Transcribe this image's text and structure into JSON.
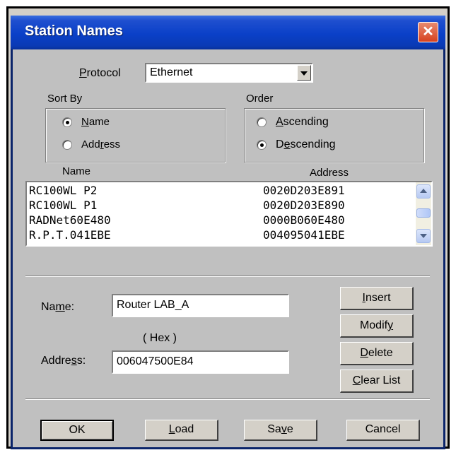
{
  "window": {
    "title": "Station Names",
    "close_symbol": "✕"
  },
  "protocol": {
    "label_pre": "",
    "label_ul": "P",
    "label_post": "rotocol",
    "value": "Ethernet"
  },
  "sort_by": {
    "title": "Sort By",
    "options": [
      {
        "pre": "",
        "ul": "N",
        "post": "ame",
        "selected": true
      },
      {
        "pre": "Add",
        "ul": "r",
        "post": "ess",
        "selected": false
      }
    ]
  },
  "order": {
    "title": "Order",
    "options": [
      {
        "pre": "",
        "ul": "A",
        "post": "scending",
        "selected": false
      },
      {
        "pre": "D",
        "ul": "e",
        "post": "scending",
        "selected": true
      }
    ]
  },
  "list": {
    "col_name": "Name",
    "col_address": "Address",
    "rows": [
      {
        "name": "RC100WL P2",
        "address": "0020D203E891"
      },
      {
        "name": "RC100WL P1",
        "address": "0020D203E890"
      },
      {
        "name": "RADNet60E480",
        "address": "0000B060E480"
      },
      {
        "name": "R.P.T.041EBE",
        "address": "004095041EBE"
      }
    ]
  },
  "form": {
    "name_label": {
      "pre": "Na",
      "ul": "m",
      "post": "e:"
    },
    "name_value": "Router LAB_A",
    "hex_label": "( Hex )",
    "address_label": {
      "pre": "Addre",
      "ul": "s",
      "post": "s:"
    },
    "address_value": "006047500E84"
  },
  "side_buttons": {
    "insert": {
      "pre": "",
      "ul": "I",
      "post": "nsert"
    },
    "modify": {
      "pre": "Modif",
      "ul": "y",
      "post": ""
    },
    "delete": {
      "pre": "",
      "ul": "D",
      "post": "elete"
    },
    "clear": {
      "pre": "",
      "ul": "C",
      "post": "lear List"
    }
  },
  "bottom_buttons": {
    "ok": {
      "pre": "OK",
      "ul": "",
      "post": ""
    },
    "load": {
      "pre": "",
      "ul": "L",
      "post": "oad"
    },
    "save": {
      "pre": "Sa",
      "ul": "v",
      "post": "e"
    },
    "cancel": {
      "pre": "Cancel",
      "ul": "",
      "post": ""
    }
  }
}
